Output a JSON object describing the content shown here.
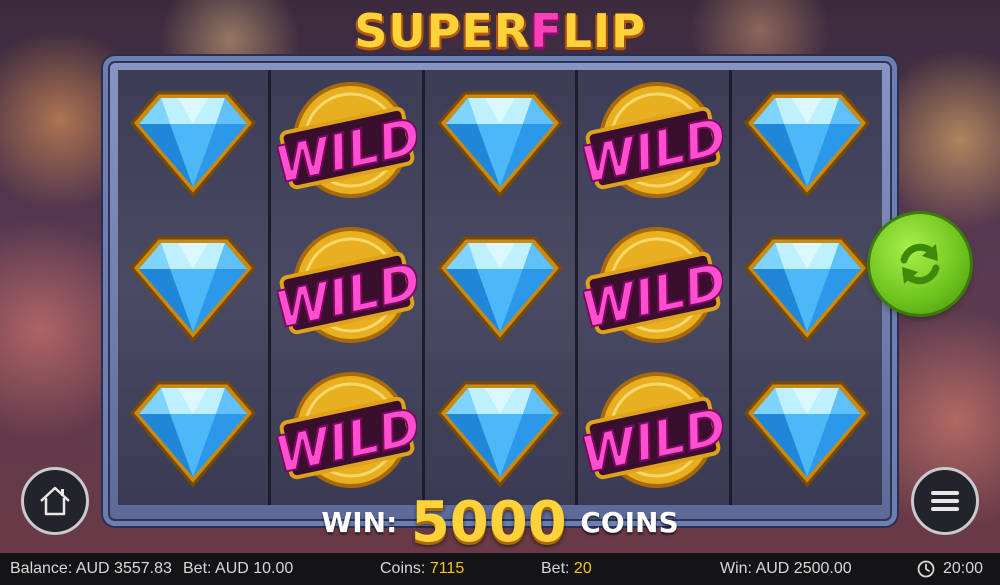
{
  "game": {
    "logo_part1": "SUPER",
    "logo_part2": "F",
    "logo_part3": "LIP"
  },
  "reels": [
    [
      "diamond",
      "diamond",
      "diamond"
    ],
    [
      "wild",
      "wild",
      "wild"
    ],
    [
      "diamond",
      "diamond",
      "diamond"
    ],
    [
      "wild",
      "wild",
      "wild"
    ],
    [
      "diamond",
      "diamond",
      "diamond"
    ]
  ],
  "wild_text": "WILD",
  "win": {
    "label": "WIN:",
    "amount": "5000",
    "unit": "COINS"
  },
  "controls": {
    "spin_icon": "refresh-icon",
    "home_icon": "home-icon",
    "menu_icon": "hamburger-menu-icon"
  },
  "status": {
    "balance_label": "Balance:",
    "balance_value": "AUD 3557.83",
    "bet_label": "Bet:",
    "bet_value": "AUD 10.00",
    "coins_label": "Coins:",
    "coins_value": "7115",
    "coinbet_label": "Bet:",
    "coinbet_value": "20",
    "win_label": "Win:",
    "win_value": "AUD 2500.00",
    "time": "20:00"
  },
  "colors": {
    "accent_yellow": "#ffd23a",
    "spin_green": "#6cc21c",
    "logo_pink": "#ff3fb8"
  }
}
